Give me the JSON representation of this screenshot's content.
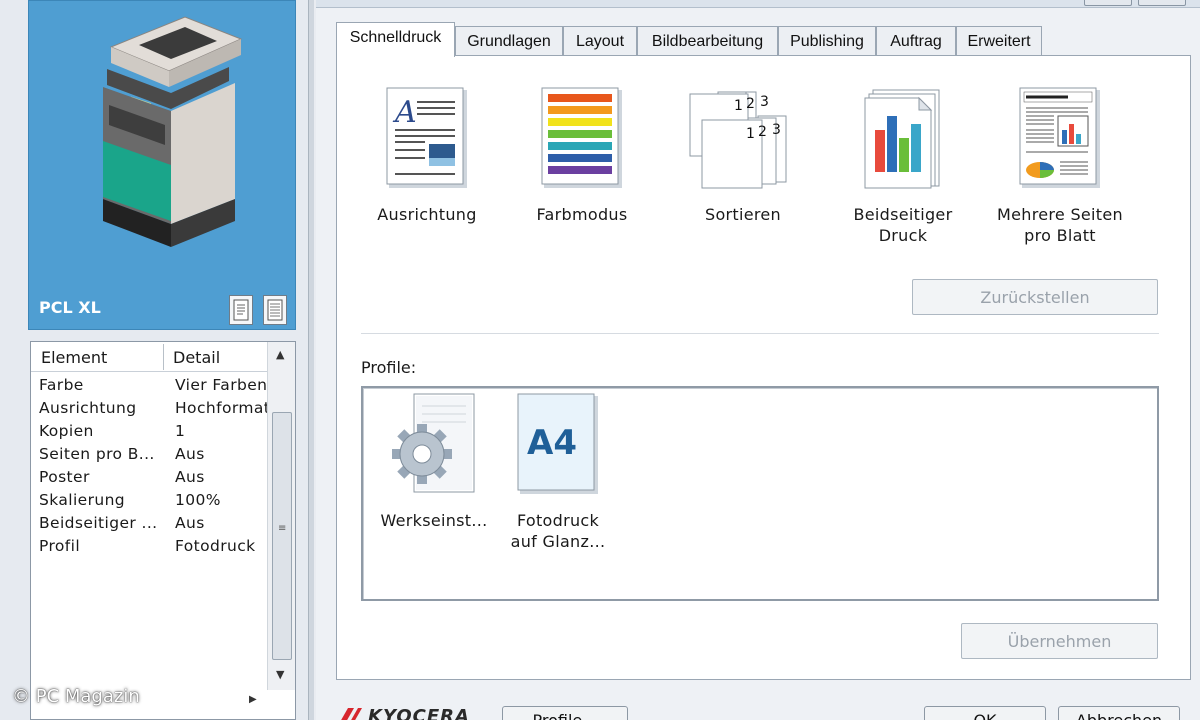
{
  "preview": {
    "printer_language": "PCL XL"
  },
  "details": {
    "columns": [
      "Element",
      "Detail"
    ],
    "rows": [
      {
        "element": "Farbe",
        "detail": "Vier Farben"
      },
      {
        "element": "Ausrichtung",
        "detail": "Hochformat"
      },
      {
        "element": "Kopien",
        "detail": "1"
      },
      {
        "element": "Seiten pro B...",
        "detail": "Aus"
      },
      {
        "element": "Poster",
        "detail": "Aus"
      },
      {
        "element": "Skalierung",
        "detail": "100%"
      },
      {
        "element": "Beidseitiger ...",
        "detail": "Aus"
      },
      {
        "element": "Profil",
        "detail": "Fotodruck"
      }
    ]
  },
  "tabs": [
    "Schnelldruck",
    "Grundlagen",
    "Layout",
    "Bildbearbeitung",
    "Publishing",
    "Auftrag",
    "Erweitert"
  ],
  "active_tab": "Schnelldruck",
  "quickprint": {
    "orientation": "Ausrichtung",
    "color_mode": "Farbmodus",
    "collate": "Sortieren",
    "duplex_line1": "Beidseitiger",
    "duplex_line2": "Druck",
    "multipage_line1": "Mehrere Seiten",
    "multipage_line2": "pro Blatt",
    "collate_numbers": [
      "1",
      "2",
      "3"
    ]
  },
  "buttons": {
    "reset": "Zurückstellen",
    "apply": "Übernehmen",
    "profile": "Profile...",
    "ok": "OK",
    "cancel": "Abbrechen"
  },
  "profiles": {
    "label": "Profile:",
    "items": [
      {
        "line1": "Werkseinst...",
        "line2": ""
      },
      {
        "line1": "Fotodruck",
        "line2": "auf Glanz..."
      }
    ],
    "a4_text": "A4"
  },
  "brand": "KYOCERA",
  "watermark": "© PC Magazin",
  "colors": {
    "preview_bg": "#4f9ed2",
    "printer_accent": "#1aa58a"
  }
}
